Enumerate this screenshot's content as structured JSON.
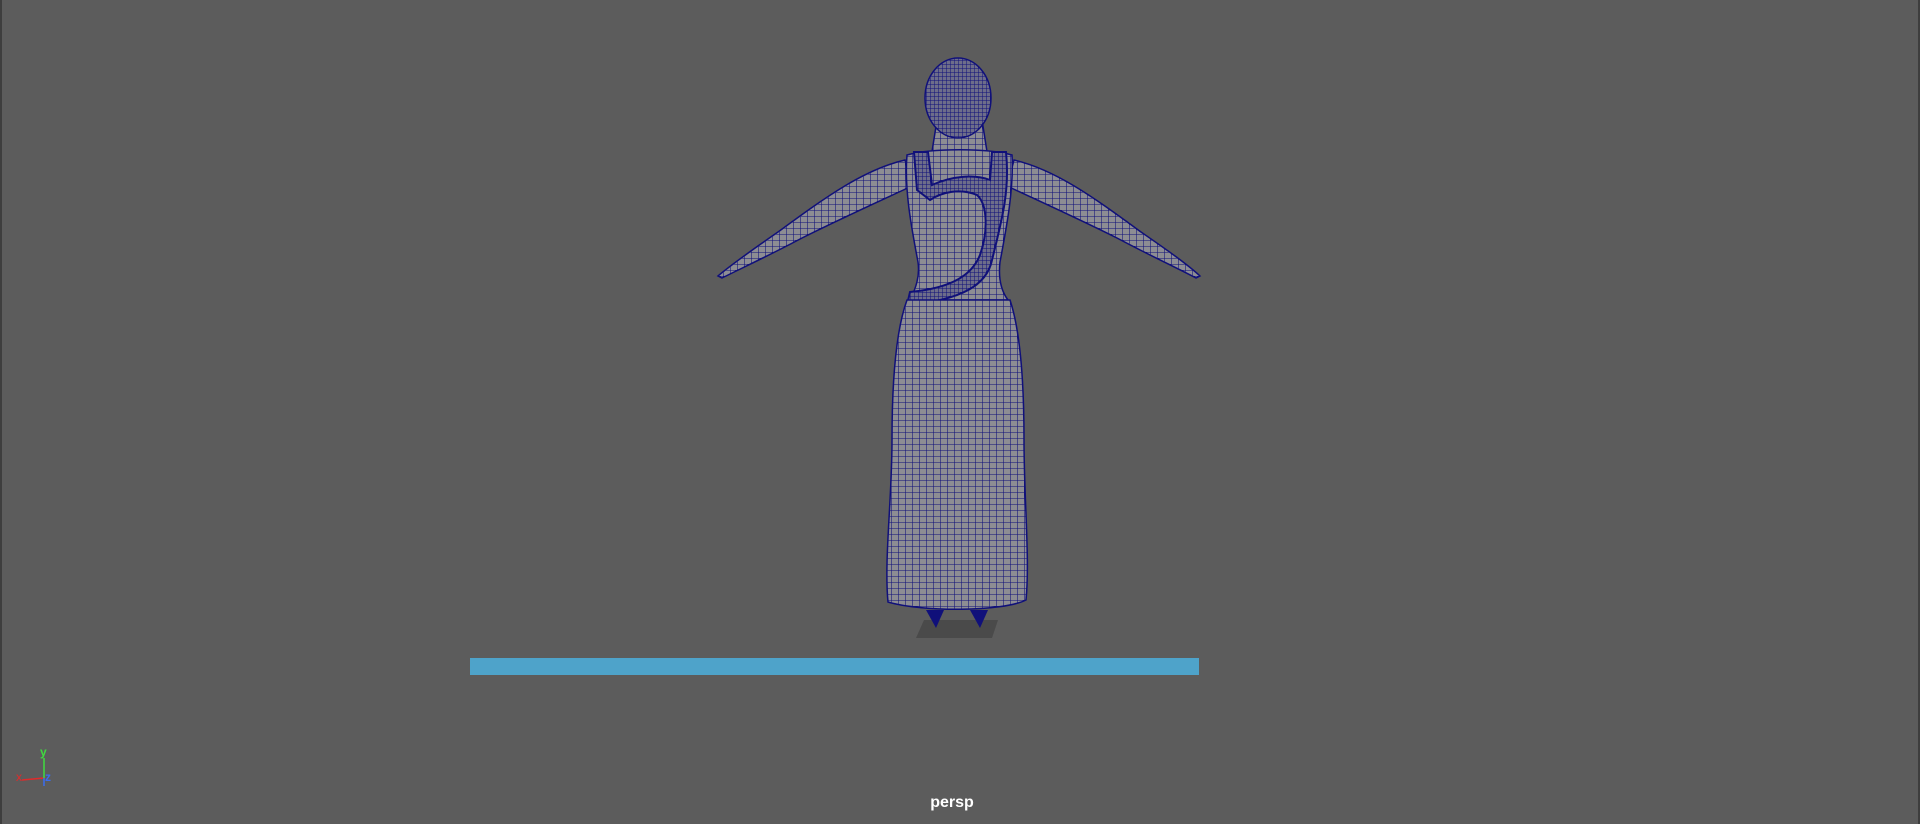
{
  "viewport": {
    "camera_name": "persp",
    "background_color": "#5c5c5c",
    "wireframe_color": "#10107a",
    "mesh_fill_color": "#8d8d93"
  },
  "progress": {
    "fraction": 1.0,
    "color": "#4ea3ca"
  },
  "axis": {
    "x_label": "x",
    "y_label": "y",
    "z_label": "z",
    "x_color": "#e02a2a",
    "y_color": "#3fdc3f",
    "z_color": "#3a6cf0"
  }
}
